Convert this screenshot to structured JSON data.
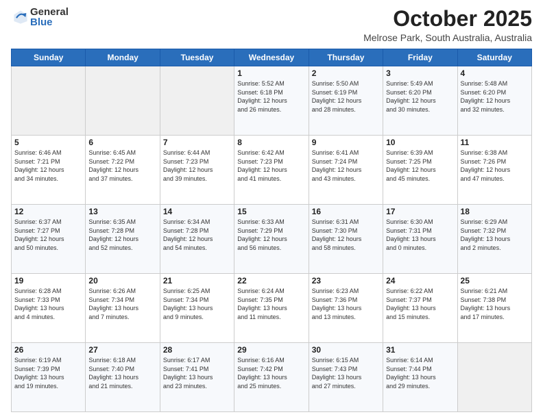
{
  "logo": {
    "general": "General",
    "blue": "Blue"
  },
  "header": {
    "month": "October 2025",
    "location": "Melrose Park, South Australia, Australia"
  },
  "days_of_week": [
    "Sunday",
    "Monday",
    "Tuesday",
    "Wednesday",
    "Thursday",
    "Friday",
    "Saturday"
  ],
  "weeks": [
    [
      {
        "day": "",
        "info": ""
      },
      {
        "day": "",
        "info": ""
      },
      {
        "day": "",
        "info": ""
      },
      {
        "day": "1",
        "info": "Sunrise: 5:52 AM\nSunset: 6:18 PM\nDaylight: 12 hours\nand 26 minutes."
      },
      {
        "day": "2",
        "info": "Sunrise: 5:50 AM\nSunset: 6:19 PM\nDaylight: 12 hours\nand 28 minutes."
      },
      {
        "day": "3",
        "info": "Sunrise: 5:49 AM\nSunset: 6:20 PM\nDaylight: 12 hours\nand 30 minutes."
      },
      {
        "day": "4",
        "info": "Sunrise: 5:48 AM\nSunset: 6:20 PM\nDaylight: 12 hours\nand 32 minutes."
      }
    ],
    [
      {
        "day": "5",
        "info": "Sunrise: 6:46 AM\nSunset: 7:21 PM\nDaylight: 12 hours\nand 34 minutes."
      },
      {
        "day": "6",
        "info": "Sunrise: 6:45 AM\nSunset: 7:22 PM\nDaylight: 12 hours\nand 37 minutes."
      },
      {
        "day": "7",
        "info": "Sunrise: 6:44 AM\nSunset: 7:23 PM\nDaylight: 12 hours\nand 39 minutes."
      },
      {
        "day": "8",
        "info": "Sunrise: 6:42 AM\nSunset: 7:23 PM\nDaylight: 12 hours\nand 41 minutes."
      },
      {
        "day": "9",
        "info": "Sunrise: 6:41 AM\nSunset: 7:24 PM\nDaylight: 12 hours\nand 43 minutes."
      },
      {
        "day": "10",
        "info": "Sunrise: 6:39 AM\nSunset: 7:25 PM\nDaylight: 12 hours\nand 45 minutes."
      },
      {
        "day": "11",
        "info": "Sunrise: 6:38 AM\nSunset: 7:26 PM\nDaylight: 12 hours\nand 47 minutes."
      }
    ],
    [
      {
        "day": "12",
        "info": "Sunrise: 6:37 AM\nSunset: 7:27 PM\nDaylight: 12 hours\nand 50 minutes."
      },
      {
        "day": "13",
        "info": "Sunrise: 6:35 AM\nSunset: 7:28 PM\nDaylight: 12 hours\nand 52 minutes."
      },
      {
        "day": "14",
        "info": "Sunrise: 6:34 AM\nSunset: 7:28 PM\nDaylight: 12 hours\nand 54 minutes."
      },
      {
        "day": "15",
        "info": "Sunrise: 6:33 AM\nSunset: 7:29 PM\nDaylight: 12 hours\nand 56 minutes."
      },
      {
        "day": "16",
        "info": "Sunrise: 6:31 AM\nSunset: 7:30 PM\nDaylight: 12 hours\nand 58 minutes."
      },
      {
        "day": "17",
        "info": "Sunrise: 6:30 AM\nSunset: 7:31 PM\nDaylight: 13 hours\nand 0 minutes."
      },
      {
        "day": "18",
        "info": "Sunrise: 6:29 AM\nSunset: 7:32 PM\nDaylight: 13 hours\nand 2 minutes."
      }
    ],
    [
      {
        "day": "19",
        "info": "Sunrise: 6:28 AM\nSunset: 7:33 PM\nDaylight: 13 hours\nand 4 minutes."
      },
      {
        "day": "20",
        "info": "Sunrise: 6:26 AM\nSunset: 7:34 PM\nDaylight: 13 hours\nand 7 minutes."
      },
      {
        "day": "21",
        "info": "Sunrise: 6:25 AM\nSunset: 7:34 PM\nDaylight: 13 hours\nand 9 minutes."
      },
      {
        "day": "22",
        "info": "Sunrise: 6:24 AM\nSunset: 7:35 PM\nDaylight: 13 hours\nand 11 minutes."
      },
      {
        "day": "23",
        "info": "Sunrise: 6:23 AM\nSunset: 7:36 PM\nDaylight: 13 hours\nand 13 minutes."
      },
      {
        "day": "24",
        "info": "Sunrise: 6:22 AM\nSunset: 7:37 PM\nDaylight: 13 hours\nand 15 minutes."
      },
      {
        "day": "25",
        "info": "Sunrise: 6:21 AM\nSunset: 7:38 PM\nDaylight: 13 hours\nand 17 minutes."
      }
    ],
    [
      {
        "day": "26",
        "info": "Sunrise: 6:19 AM\nSunset: 7:39 PM\nDaylight: 13 hours\nand 19 minutes."
      },
      {
        "day": "27",
        "info": "Sunrise: 6:18 AM\nSunset: 7:40 PM\nDaylight: 13 hours\nand 21 minutes."
      },
      {
        "day": "28",
        "info": "Sunrise: 6:17 AM\nSunset: 7:41 PM\nDaylight: 13 hours\nand 23 minutes."
      },
      {
        "day": "29",
        "info": "Sunrise: 6:16 AM\nSunset: 7:42 PM\nDaylight: 13 hours\nand 25 minutes."
      },
      {
        "day": "30",
        "info": "Sunrise: 6:15 AM\nSunset: 7:43 PM\nDaylight: 13 hours\nand 27 minutes."
      },
      {
        "day": "31",
        "info": "Sunrise: 6:14 AM\nSunset: 7:44 PM\nDaylight: 13 hours\nand 29 minutes."
      },
      {
        "day": "",
        "info": ""
      }
    ]
  ]
}
